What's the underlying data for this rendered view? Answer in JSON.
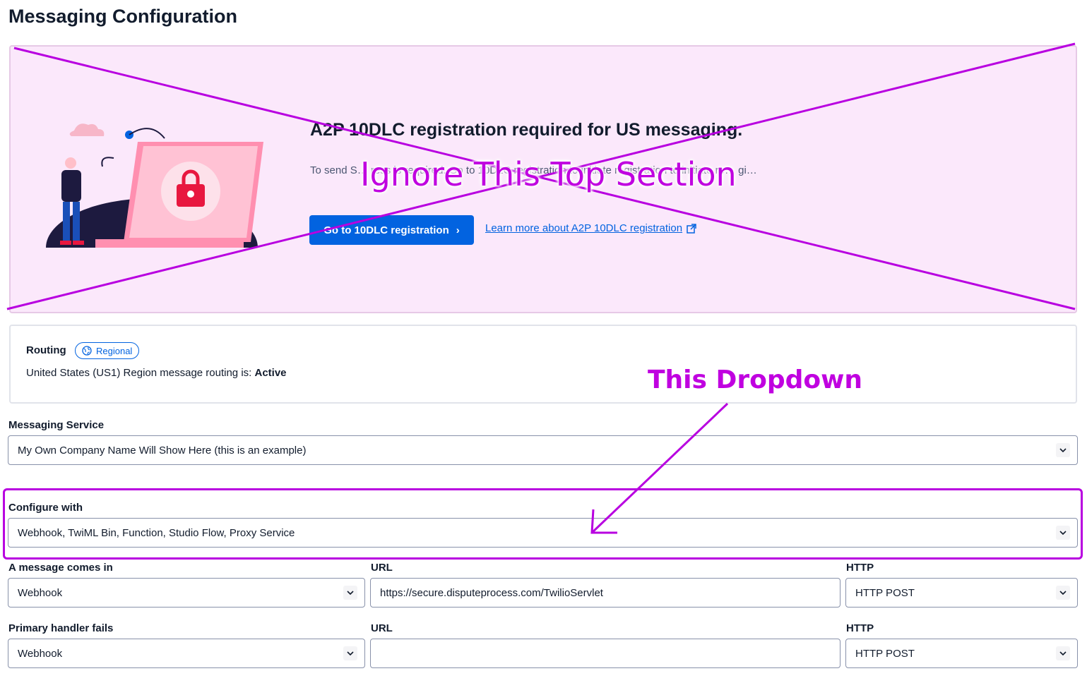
{
  "page": {
    "title": "Messaging Configuration"
  },
  "banner": {
    "heading": "A2P 10DLC registration required for US messaging.",
    "body": "To send S… ress is required. Go to 10DLC registration to initiate registration to initiate re… gi…",
    "cta_label": "Go to 10DLC registration",
    "link_label": "Learn more about A2P 10DLC registration"
  },
  "annotations": {
    "ignore_label": "Ignore This Top Section",
    "dropdown_label": "This Dropdown",
    "color": "#c000e0"
  },
  "routing": {
    "label": "Routing",
    "pill": "Regional",
    "status_prefix": "United States (US1) Region message routing is:",
    "status_value": "Active"
  },
  "messaging_service": {
    "label": "Messaging Service",
    "value": "My Own Company Name Will Show Here (this is an example)"
  },
  "configure_with": {
    "label": "Configure with",
    "value": "Webhook, TwiML Bin, Function, Studio Flow, Proxy Service"
  },
  "message_comes_in": {
    "label": "A message comes in",
    "type": "Webhook",
    "url_label": "URL",
    "url": "https://secure.disputeprocess.com/TwilioServlet",
    "http_label": "HTTP",
    "http": "HTTP POST"
  },
  "primary_handler_fails": {
    "label": "Primary handler fails",
    "type": "Webhook",
    "url_label": "URL",
    "url": "",
    "http_label": "HTTP",
    "http": "HTTP POST"
  },
  "colors": {
    "primary": "#0263e0",
    "banner_bg": "#fbe8fb",
    "annotation": "#c000e0"
  }
}
